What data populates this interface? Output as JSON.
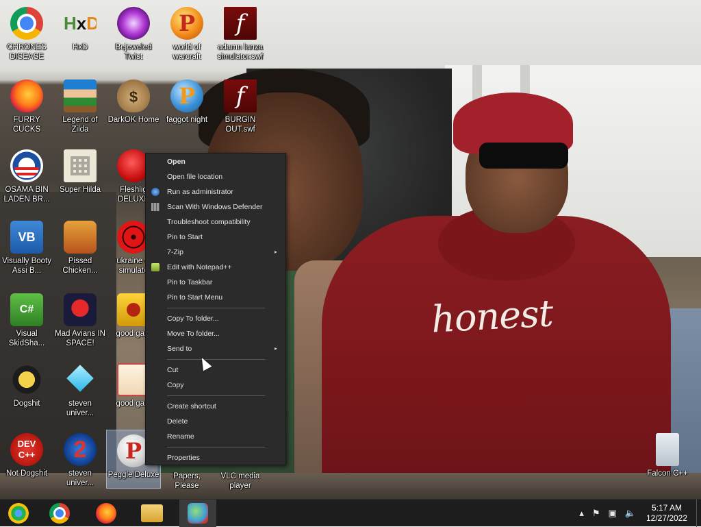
{
  "desktop": {
    "wallpaper_text": "honest",
    "icons": [
      {
        "label": "CHRONES DISEASE",
        "icon": "chrome-icon"
      },
      {
        "label": "HxD",
        "icon": "hxd-icon"
      },
      {
        "label": "Bejeweled Twist",
        "icon": "bejeweled-icon"
      },
      {
        "label": "world of warcraft",
        "icon": "peggle-icon"
      },
      {
        "label": "adamn lanza simulator.swf",
        "icon": "flash-icon"
      },
      {
        "label": "FURRY CUCKS",
        "icon": "firefox-icon"
      },
      {
        "label": "Legend of Zilda",
        "icon": "pixel-character-icon"
      },
      {
        "label": "DarkOK Home",
        "icon": "money-bag-icon"
      },
      {
        "label": "faggot night",
        "icon": "peggle-blue-icon"
      },
      {
        "label": "BURGIN OUT.swf",
        "icon": "flash-icon"
      },
      {
        "label": "OSAMA BIN LADEN BR...",
        "icon": "obama-logo-icon"
      },
      {
        "label": "Super Hilda",
        "icon": "pixel-cat-icon"
      },
      {
        "label": "Fleshlig DELUXE",
        "icon": "red-blob-icon"
      },
      {
        "label": "Visually Booty Assi B...",
        "icon": "visual-basic-icon"
      },
      {
        "label": "Pissed Chicken...",
        "icon": "seasons-icon"
      },
      {
        "label": "ukraine w simulato",
        "icon": "radiation-icon"
      },
      {
        "label": "Visual SkidSha...",
        "icon": "visual-csharp-icon"
      },
      {
        "label": "Mad Avians IN SPACE!",
        "icon": "angry-birds-space-icon"
      },
      {
        "label": "good gam",
        "icon": "yellow-box-icon"
      },
      {
        "label": "Dogshit",
        "icon": "cpp-bird-icon"
      },
      {
        "label": "steven univer...",
        "icon": "diamond-icon"
      },
      {
        "label": "good gam",
        "icon": "torii-icon"
      },
      {
        "label": "Not Dogshit",
        "icon": "dev-cpp-icon"
      },
      {
        "label": "steven univer...",
        "icon": "number-two-icon"
      },
      {
        "label": "Peggle Deluxe",
        "icon": "peggle-white-icon"
      },
      {
        "label": "Papers, Please",
        "icon": "papers-icon"
      },
      {
        "label": "VLC media player",
        "icon": "vlc-icon"
      },
      {
        "label": "Falcon C++",
        "icon": "recycle-bin-icon"
      }
    ],
    "dev_text": "DEV C++",
    "two_text": "2",
    "p_text": "P",
    "vb_text": "VB",
    "cs_text": "C#",
    "flash_text": "f"
  },
  "context_menu": {
    "items": [
      {
        "label": "Open",
        "bold": true
      },
      {
        "label": "Open file location"
      },
      {
        "label": "Run as administrator",
        "icon": "shield-icon"
      },
      {
        "label": "Scan With Windows Defender",
        "icon": "defender-icon"
      },
      {
        "label": "Troubleshoot compatibility"
      },
      {
        "label": "Pin to Start"
      },
      {
        "label": "7-Zip",
        "submenu": true
      },
      {
        "label": "Edit with Notepad++",
        "icon": "notepad-plus-plus-icon"
      },
      {
        "label": "Pin to Taskbar"
      },
      {
        "label": "Pin to Start Menu"
      },
      {
        "label": "Copy To folder..."
      },
      {
        "label": "Move To folder..."
      },
      {
        "label": "Send to",
        "submenu": true
      },
      {
        "label": "Cut"
      },
      {
        "label": "Copy"
      },
      {
        "label": "Create shortcut"
      },
      {
        "label": "Delete"
      },
      {
        "label": "Rename"
      },
      {
        "label": "Properties"
      }
    ],
    "submenu_arrow": "▸"
  },
  "taskbar": {
    "buttons": [
      {
        "name": "start-button",
        "icon": "start-orb-icon"
      },
      {
        "name": "chrome-taskbar-button",
        "icon": "chrome-icon"
      },
      {
        "name": "firefox-taskbar-button",
        "icon": "firefox-icon"
      },
      {
        "name": "file-explorer-taskbar-button",
        "icon": "folder-icon"
      },
      {
        "name": "network-taskbar-button",
        "icon": "network-icon",
        "active": true
      }
    ],
    "tray": {
      "chevron": "▴",
      "flag": "⚑",
      "network": "▣",
      "volume": "🔈",
      "time": "5:17 AM",
      "date": "12/27/2022"
    }
  }
}
